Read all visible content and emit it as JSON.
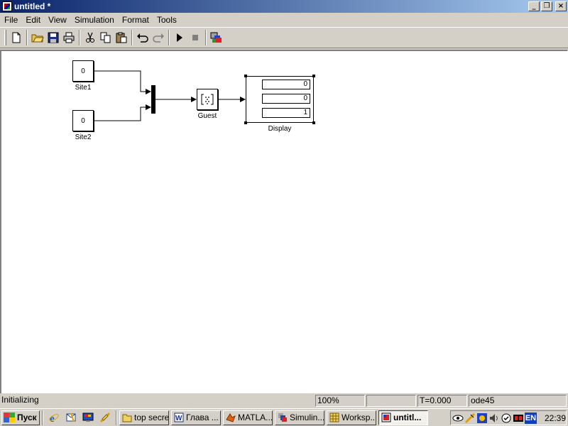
{
  "window": {
    "title": "untitled *"
  },
  "menu": [
    "File",
    "Edit",
    "View",
    "Simulation",
    "Format",
    "Tools"
  ],
  "toolbar": [
    "new-icon",
    "open-icon",
    "save-icon",
    "print-icon",
    "cut-icon",
    "copy-icon",
    "paste-icon",
    "undo-icon",
    "redo-icon",
    "start-simulation-icon",
    "stop-simulation-icon",
    "library-browser-icon"
  ],
  "model": {
    "site1": {
      "value": "0",
      "label": "Site1"
    },
    "site2": {
      "value": "0",
      "label": "Site2"
    },
    "guest": {
      "label": "Guest"
    },
    "display": {
      "label": "Display",
      "values": [
        "0",
        "0",
        "1"
      ]
    }
  },
  "status": {
    "message": "Initializing",
    "zoom": "100%",
    "blank": "",
    "time": "T=0.000",
    "solver": "ode45"
  },
  "taskbar": {
    "start_label": "Пуск",
    "tasks": [
      "top secret",
      "Глава ...",
      "MATLA...",
      "Simulin...",
      "Worksp...",
      "untitl..."
    ],
    "tray_lang": "EN",
    "clock": "22:39"
  }
}
